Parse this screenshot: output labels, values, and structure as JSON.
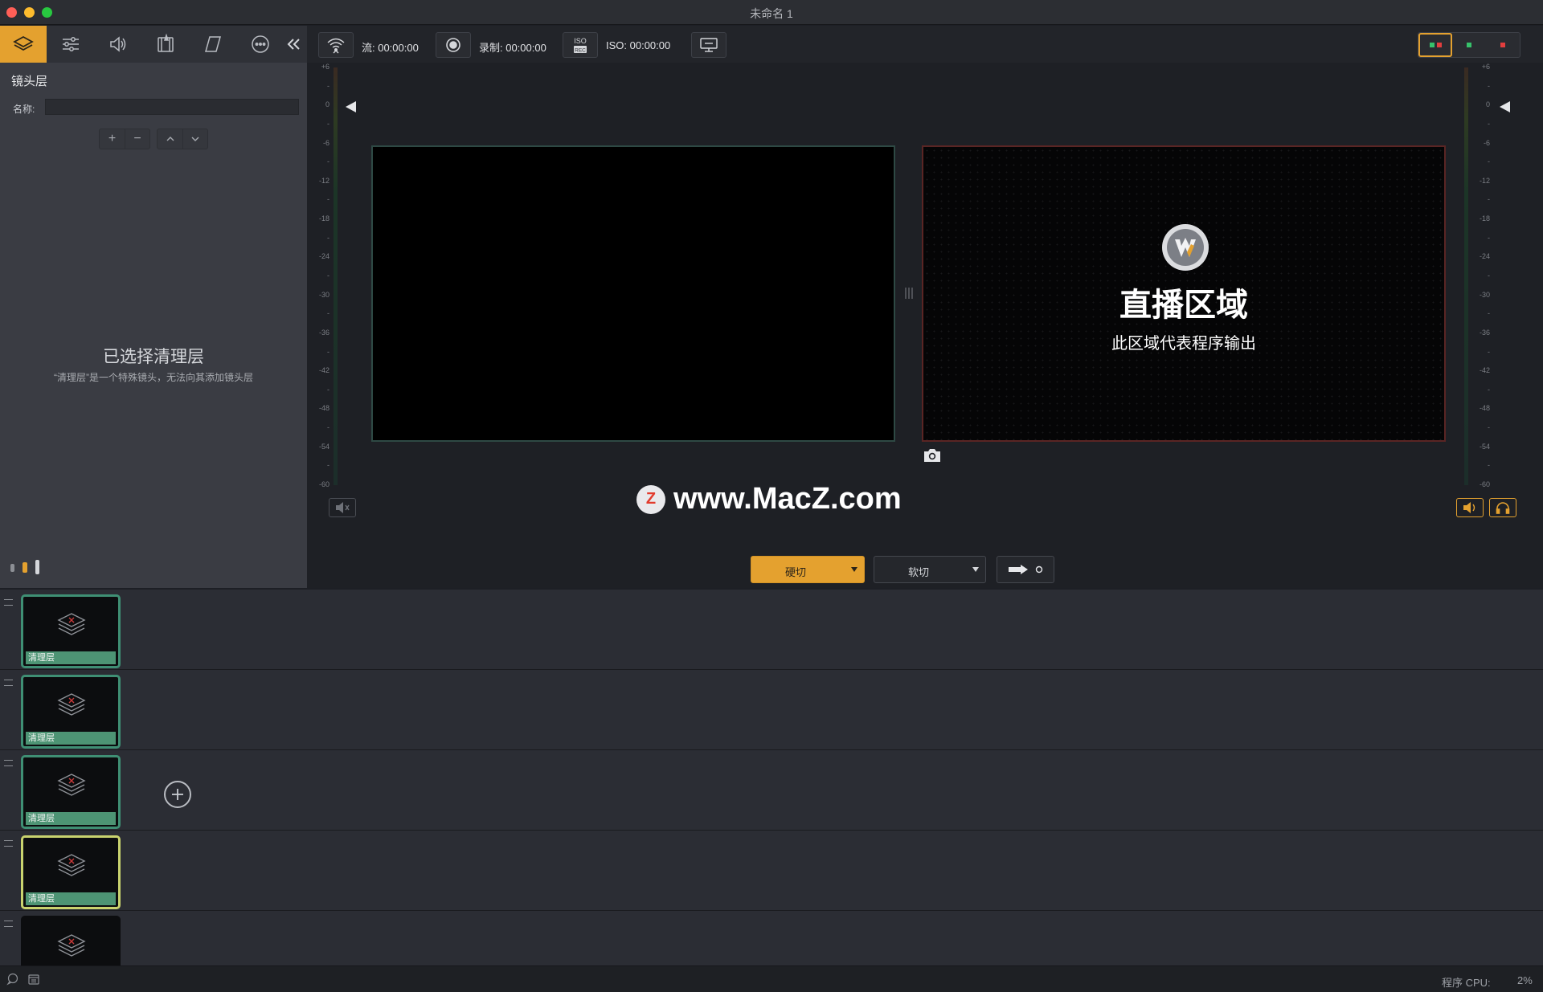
{
  "window": {
    "title": "未命名 1"
  },
  "left_toolbar": {
    "tabs": [
      {
        "icon": "layers-icon",
        "active": true
      },
      {
        "icon": "sliders-icon",
        "active": false
      },
      {
        "icon": "speaker-icon",
        "active": false
      },
      {
        "icon": "filmstrip-edit-icon",
        "active": false
      },
      {
        "icon": "parallelogram-icon",
        "active": false
      },
      {
        "icon": "more-icon",
        "active": false
      }
    ],
    "collapse_icon": "double-chevron-left-icon"
  },
  "layer_panel": {
    "title": "镜头层",
    "name_label": "名称:",
    "name_value": "",
    "empty_title": "已选择清理层",
    "empty_desc": "“清理层”是一个特殊镜头，无法向其添加镜头层"
  },
  "top_toolbar": {
    "stream_label": "流: 00:00:00",
    "record_label": "录制: 00:00:00",
    "iso_label": "ISO: 00:00:00",
    "iso_icon_text": "ISO REC",
    "layouts": [
      {
        "name": "dual",
        "active": true
      },
      {
        "name": "preview-only",
        "active": false
      },
      {
        "name": "live-only",
        "active": false
      }
    ]
  },
  "meters": {
    "scale": [
      "+6",
      "-",
      "0",
      "-",
      "-6",
      "-",
      "-12",
      "-",
      "-18",
      "-",
      "-24",
      "-",
      "-30",
      "-",
      "-36",
      "-",
      "-42",
      "-",
      "-48",
      "-",
      "-54",
      "-",
      "-60"
    ]
  },
  "live_area": {
    "title": "直播区域",
    "subtitle": "此区域代表程序输出"
  },
  "watermark": {
    "text": "www.MacZ.com",
    "logo_letter": "Z"
  },
  "transitions": {
    "hard_cut": "硬切",
    "soft_cut": "软切"
  },
  "shots": [
    {
      "label": "清理层",
      "selected": false
    },
    {
      "label": "清理层",
      "selected": false
    },
    {
      "label": "清理层",
      "selected": false
    },
    {
      "label": "清理层",
      "selected": true
    },
    {
      "label": "",
      "selected": false
    }
  ],
  "status_bar": {
    "cpu_label": "程序 CPU:",
    "cpu_value": "2%"
  },
  "colors": {
    "accent": "#e4a12f",
    "shot_border": "#3f8f74",
    "shot_selected_border": "#c9d36e",
    "live_border": "#5a2524",
    "preview_border": "#2e4944"
  }
}
